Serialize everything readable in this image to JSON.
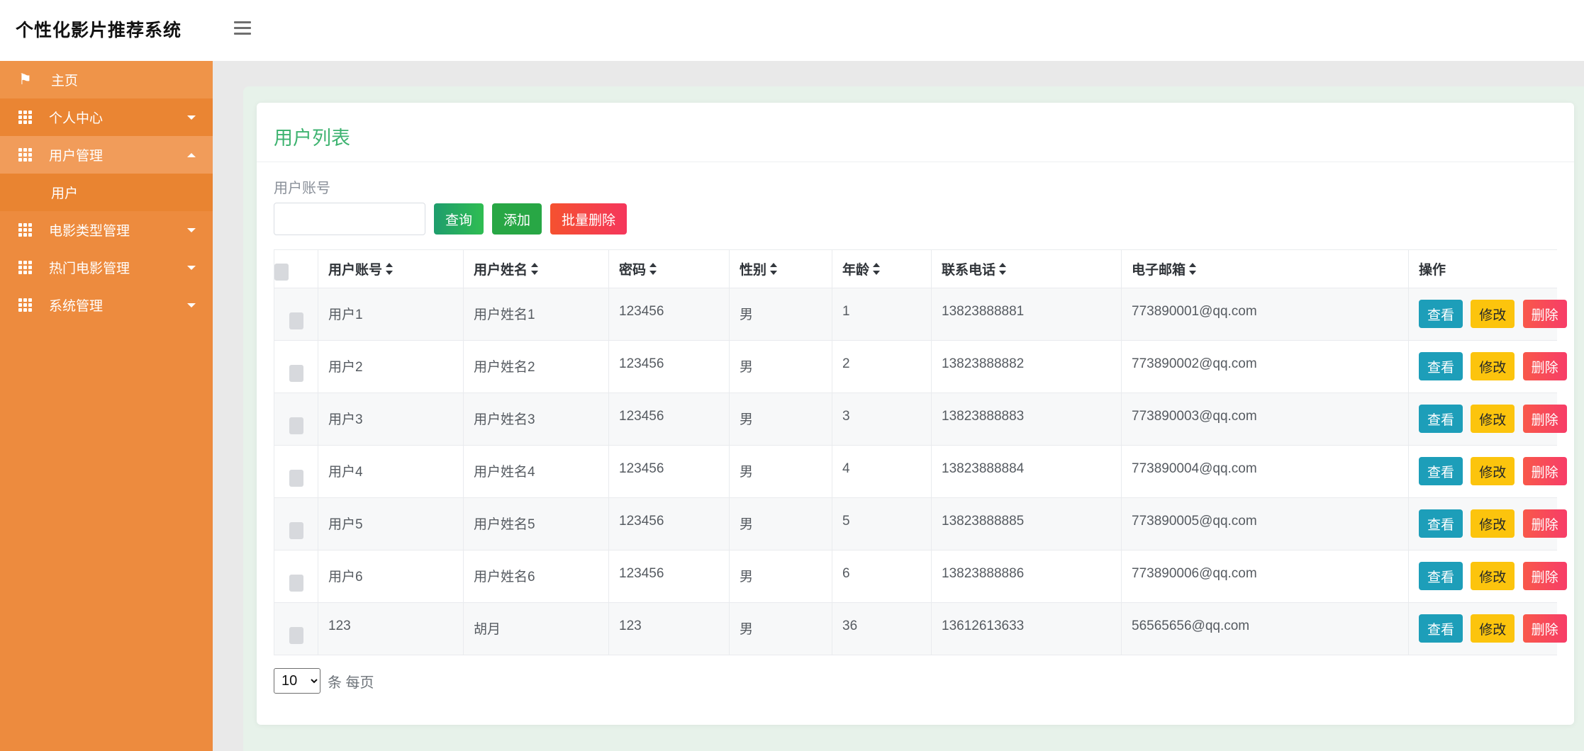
{
  "app": {
    "title": "个性化影片推荐系统"
  },
  "sidebar": {
    "items": [
      {
        "key": "home",
        "label": "主页",
        "icon": "flag",
        "caret": null,
        "variant": "home"
      },
      {
        "key": "personal-center",
        "label": "个人中心",
        "icon": "grid",
        "caret": "down",
        "variant": "darker"
      },
      {
        "key": "user-management",
        "label": "用户管理",
        "icon": "grid",
        "caret": "up",
        "variant": "active"
      },
      {
        "key": "user",
        "label": "用户",
        "icon": null,
        "caret": null,
        "variant": "submenu"
      },
      {
        "key": "movie-type-management",
        "label": "电影类型管理",
        "icon": "grid",
        "caret": "down",
        "variant": "default"
      },
      {
        "key": "hot-movie-management",
        "label": "热门电影管理",
        "icon": "grid",
        "caret": "down",
        "variant": "default"
      },
      {
        "key": "system-management",
        "label": "系统管理",
        "icon": "grid",
        "caret": "down",
        "variant": "default"
      }
    ]
  },
  "main": {
    "page_title": "用户列表",
    "search": {
      "label": "用户账号",
      "value": "",
      "buttons": {
        "query": "查询",
        "add": "添加",
        "batch_delete": "批量删除"
      }
    },
    "table": {
      "columns": [
        {
          "key": "account",
          "label": "用户账号",
          "sortable": true
        },
        {
          "key": "name",
          "label": "用户姓名",
          "sortable": true
        },
        {
          "key": "password",
          "label": "密码",
          "sortable": true
        },
        {
          "key": "gender",
          "label": "性别",
          "sortable": true
        },
        {
          "key": "age",
          "label": "年龄",
          "sortable": true
        },
        {
          "key": "phone",
          "label": "联系电话",
          "sortable": true
        },
        {
          "key": "email",
          "label": "电子邮箱",
          "sortable": true
        },
        {
          "key": "action",
          "label": "操作",
          "sortable": false
        }
      ],
      "rows": [
        {
          "account": "用户1",
          "name": "用户姓名1",
          "password": "123456",
          "gender": "男",
          "age": "1",
          "phone": "13823888881",
          "email": "773890001@qq.com"
        },
        {
          "account": "用户2",
          "name": "用户姓名2",
          "password": "123456",
          "gender": "男",
          "age": "2",
          "phone": "13823888882",
          "email": "773890002@qq.com"
        },
        {
          "account": "用户3",
          "name": "用户姓名3",
          "password": "123456",
          "gender": "男",
          "age": "3",
          "phone": "13823888883",
          "email": "773890003@qq.com"
        },
        {
          "account": "用户4",
          "name": "用户姓名4",
          "password": "123456",
          "gender": "男",
          "age": "4",
          "phone": "13823888884",
          "email": "773890004@qq.com"
        },
        {
          "account": "用户5",
          "name": "用户姓名5",
          "password": "123456",
          "gender": "男",
          "age": "5",
          "phone": "13823888885",
          "email": "773890005@qq.com"
        },
        {
          "account": "用户6",
          "name": "用户姓名6",
          "password": "123456",
          "gender": "男",
          "age": "6",
          "phone": "13823888886",
          "email": "773890006@qq.com"
        },
        {
          "account": "123",
          "name": "胡月",
          "password": "123",
          "gender": "男",
          "age": "36",
          "phone": "13612613633",
          "email": "56565656@qq.com"
        }
      ],
      "actions": {
        "view": "查看",
        "edit": "修改",
        "delete": "删除"
      }
    },
    "pagination": {
      "page_size": "10",
      "unit_label": "条 每页"
    }
  },
  "colors": {
    "sidebar_orange": "#ed8b3e",
    "sidebar_active": "#f19c5a",
    "sidebar_submenu": "#e98431",
    "title_green": "#3eb370",
    "content_bg_green": "#e7f2ea",
    "page_bg_gray": "#e9e9e9",
    "btn_query_gradient": [
      "#1f9d6d",
      "#2fbd52"
    ],
    "btn_add": "#28a745",
    "btn_batch_delete_gradient": [
      "#f5512f",
      "#f5365c"
    ],
    "btn_view": "#1d9eb9",
    "btn_edit": "#fcc40d",
    "btn_delete_gradient": [
      "#f8584a",
      "#f73d68"
    ]
  }
}
